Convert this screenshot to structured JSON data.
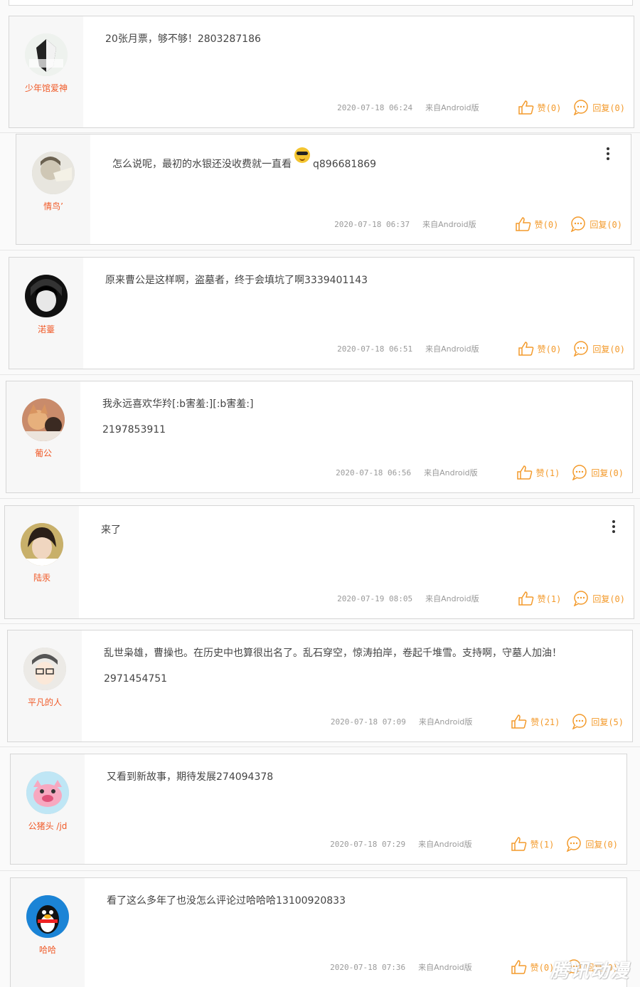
{
  "comments": [
    {
      "user": "少年馆爱神",
      "badge": "少年馆爱神",
      "text": "20张月票，够不够！2803287186",
      "text2": "",
      "time": "2020-07-18 06:24",
      "source": "来自Android版",
      "like": "赞(0)",
      "reply": "回复(0)"
    },
    {
      "user": "情鸟’",
      "text": "怎么说呢，最初的水银还没收费就一直看",
      "text_after": "q896681869",
      "text2": "",
      "time": "2020-07-18 06:37",
      "source": "来自Android版",
      "like": "赞(0)",
      "reply": "回复(0)"
    },
    {
      "user": "渃薹",
      "text": "原来曹公是这样啊，盗墓者，终于会填坑了啊3339401143",
      "text2": "",
      "time": "2020-07-18 06:51",
      "source": "来自Android版",
      "like": "赞(0)",
      "reply": "回复(0)"
    },
    {
      "user": "葡公",
      "text": "我永远喜欢华羚[:b害羞:][:b害羞:]",
      "text2": "2197853911",
      "time": "2020-07-18 06:56",
      "source": "来自Android版",
      "like": "赞(1)",
      "reply": "回复(0)"
    },
    {
      "user": "陆汞",
      "text": "来了",
      "text2": "",
      "time": "2020-07-19 08:05",
      "source": "来自Android版",
      "like": "赞(1)",
      "reply": "回复(0)"
    },
    {
      "user": "平凡的人",
      "text": "乱世枭雄，曹操也。在历史中也算很出名了。乱石穿空，惊涛拍岸，卷起千堆雪。支持啊，守墓人加油！",
      "text2": "2971454751",
      "time": "2020-07-18 07:09",
      "source": "来自Android版",
      "like": "赞(21)",
      "reply": "回复(5)"
    },
    {
      "user": "公猪头 /jd",
      "text": "又看到新故事，期待发展274094378",
      "text2": "",
      "time": "2020-07-18 07:29",
      "source": "来自Android版",
      "like": "赞(1)",
      "reply": "回复(0)"
    },
    {
      "user": "哈哈",
      "text": "看了这么多年了也没怎么评论过哈哈哈13100920833",
      "text2": "",
      "time": "2020-07-18 07:36",
      "source": "来自Android版",
      "like": "赞(0)",
      "reply": "回复(0)"
    }
  ],
  "icons": {
    "like": "thumbs-up-icon",
    "reply": "chat-bubble-icon",
    "more": "kebab-menu-icon"
  },
  "colors": {
    "accent": "#f39a2b",
    "username": "#f05a28",
    "meta": "#9a9a9a"
  },
  "watermark": "腾讯动漫"
}
